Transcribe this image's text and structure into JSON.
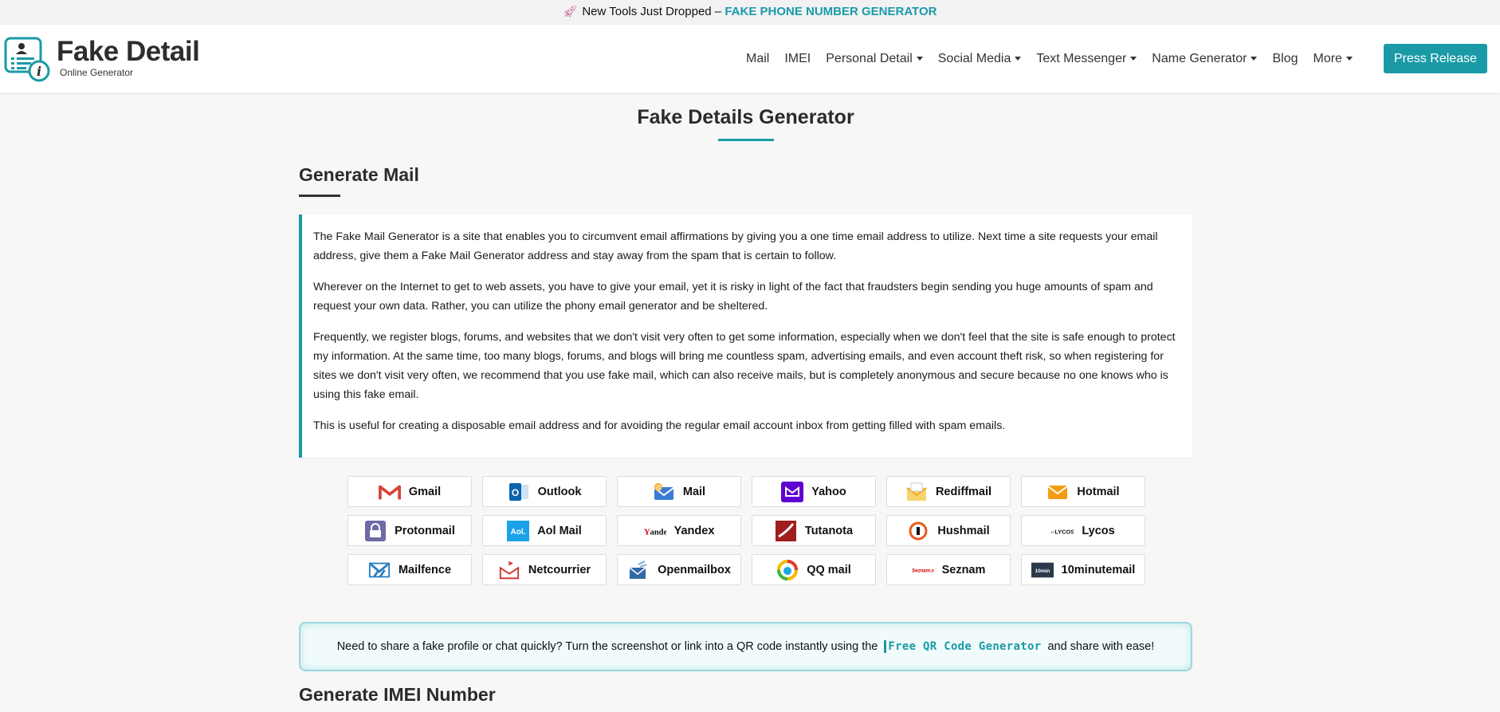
{
  "announcement": {
    "icon": "rocket-icon",
    "text": "New Tools Just Dropped – ",
    "highlight": "FAKE PHONE NUMBER GENERATOR"
  },
  "logo": {
    "title": "Fake Detail",
    "subtitle": "Online Generator"
  },
  "nav": [
    {
      "label": "Mail",
      "dropdown": false
    },
    {
      "label": "IMEI",
      "dropdown": false
    },
    {
      "label": "Personal Detail",
      "dropdown": true
    },
    {
      "label": "Social Media",
      "dropdown": true
    },
    {
      "label": "Text Messenger",
      "dropdown": true
    },
    {
      "label": "Name Generator",
      "dropdown": true
    },
    {
      "label": "Blog",
      "dropdown": false
    },
    {
      "label": "More",
      "dropdown": true
    }
  ],
  "press_release": "Press Release",
  "page_title": "Fake Details Generator",
  "section": {
    "title": "Generate Mail",
    "paragraphs": [
      "The Fake Mail Generator is a site that enables you to circumvent email affirmations by giving you a one time email address to utilize. Next time a site requests your email address, give them a Fake Mail Generator address and stay away from the spam that is certain to follow.",
      "Wherever on the Internet to get to web assets, you have to give your email, yet it is risky in light of the fact that fraudsters begin sending you huge amounts of spam and request your own data. Rather, you can utilize the phony email generator and be sheltered.",
      "Frequently, we register blogs, forums, and websites that we don't visit very often to get some information, especially when we don't feel that the site is safe enough to protect my information. At the same time, too many blogs, forums, and blogs will bring me countless spam, advertising emails, and even account theft risk, so when registering for sites we don't visit very often, we recommend that you use fake mail, which can also receive mails, but is completely anonymous and secure because no one knows who is using this fake email.",
      "This is useful for creating a disposable email address and for avoiding the regular email account inbox from getting filled with spam emails."
    ]
  },
  "providers": [
    {
      "label": "Gmail",
      "icon": "gmail-icon",
      "color": "#d44638"
    },
    {
      "label": "Outlook",
      "icon": "outlook-icon",
      "color": "#0a64ad"
    },
    {
      "label": "Mail",
      "icon": "mail-icon",
      "color": "#3a7bd5"
    },
    {
      "label": "Yahoo",
      "icon": "yahoo-icon",
      "color": "#5f01d1"
    },
    {
      "label": "Rediffmail",
      "icon": "rediffmail-icon",
      "color": "#f5a623"
    },
    {
      "label": "Hotmail",
      "icon": "hotmail-icon",
      "color": "#f39c12"
    },
    {
      "label": "Protonmail",
      "icon": "protonmail-icon",
      "color": "#6d6aa4"
    },
    {
      "label": "Aol Mail",
      "icon": "aol-icon",
      "color": "#1aa3e8"
    },
    {
      "label": "Yandex",
      "icon": "yandex-icon",
      "color": "#111111"
    },
    {
      "label": "Tutanota",
      "icon": "tutanota-icon",
      "color": "#a01e1e"
    },
    {
      "label": "Hushmail",
      "icon": "hushmail-icon",
      "color": "#e65a1c"
    },
    {
      "label": "Lycos",
      "icon": "lycos-icon",
      "color": "#111111"
    },
    {
      "label": "Mailfence",
      "icon": "mailfence-icon",
      "color": "#2a7fc1"
    },
    {
      "label": "Netcourrier",
      "icon": "netcourrier-icon",
      "color": "#d0312d"
    },
    {
      "label": "Openmailbox",
      "icon": "openmailbox-icon",
      "color": "#3469a8"
    },
    {
      "label": "QQ mail",
      "icon": "qqmail-icon",
      "color": "#1ea7e0"
    },
    {
      "label": "Seznam",
      "icon": "seznam-icon",
      "color": "#cc0000"
    },
    {
      "label": "10minutemail",
      "icon": "10minutemail-icon",
      "color": "#2b3a4a"
    }
  ],
  "qr_promo": {
    "before": "Need to share a fake profile or chat quickly? Turn the screenshot or link into a QR code instantly using the ",
    "link": "Free QR Code Generator",
    "after": " and share with ease!"
  },
  "next_section_title": "Generate IMEI Number",
  "colors": {
    "accent": "#1a9aa6",
    "background": "#f7f7f7"
  }
}
